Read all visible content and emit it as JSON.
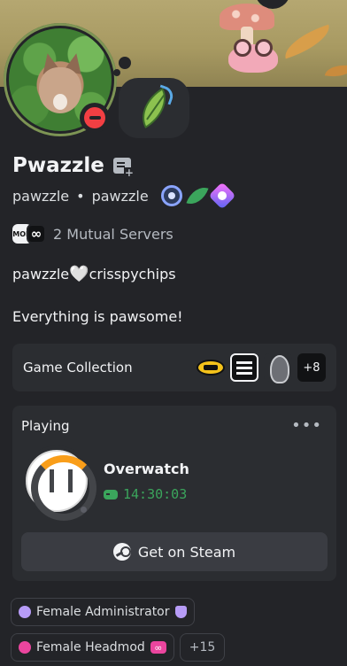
{
  "profile": {
    "display_name": "Pwazzle",
    "username": "pawzzle",
    "separator": "•",
    "pronouns_user": "pawzzle",
    "status": "do-not-disturb",
    "custom_status_emoji": "leaf-wind"
  },
  "mutual": {
    "text": "2 Mutual Servers",
    "server_icons": [
      "MOD",
      "∞"
    ]
  },
  "about": {
    "line1_left": "pawzzle",
    "heart": "🤍",
    "line1_right": "crisspychips",
    "bio": "Everything is pawsome!"
  },
  "game_collection": {
    "label": "Game Collection",
    "icons": [
      "batman-icon",
      "grid-game-icon",
      "skyrim-icon"
    ],
    "more": "+8"
  },
  "activity": {
    "title": "Playing",
    "menu": "•••",
    "game": "Overwatch",
    "elapsed": "14:30:03",
    "button": "Get on Steam"
  },
  "roles": [
    {
      "name": "Female Administrator",
      "color": "#b79cf7"
    },
    {
      "name": "Female Headmod",
      "color": "#eb459e"
    }
  ],
  "roles_more": "+15",
  "colors": {
    "background": "#232428",
    "card": "#2b2d31",
    "dnd": "#f23f43",
    "playing_green": "#3ba55c",
    "overwatch_orange": "#f99e1a"
  }
}
